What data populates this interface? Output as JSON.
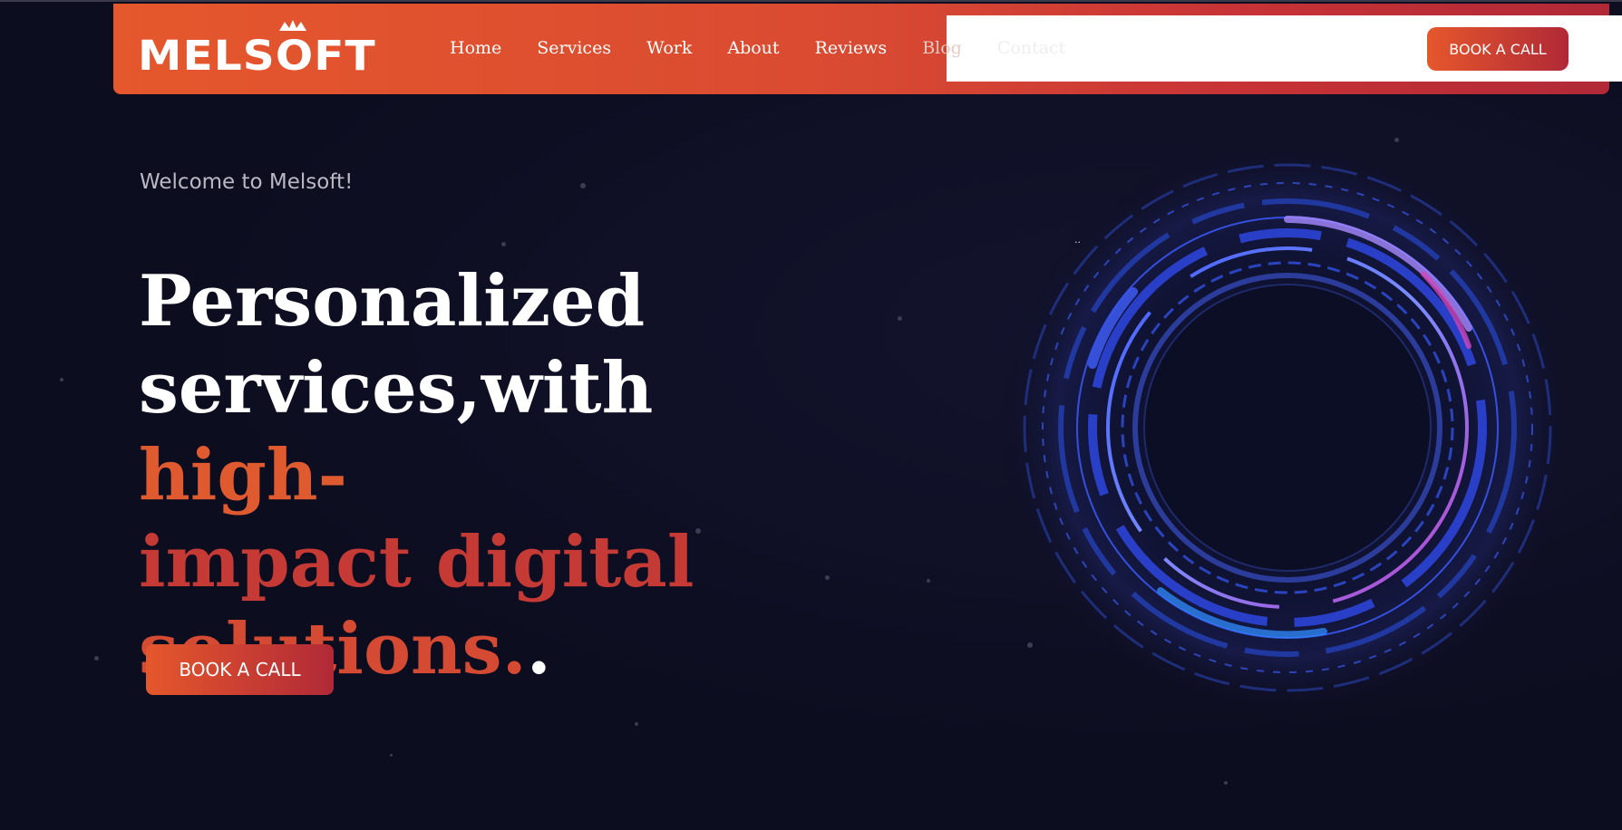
{
  "brand": {
    "name": "MELSOFT"
  },
  "nav": {
    "items": [
      {
        "label": "Home"
      },
      {
        "label": "Services"
      },
      {
        "label": "Work"
      },
      {
        "label": "About"
      },
      {
        "label": "Reviews"
      },
      {
        "label": "Blog"
      },
      {
        "label": "Contact"
      }
    ],
    "cta_label": "BOOK A CALL"
  },
  "hero": {
    "welcome": "Welcome to Melsoft!",
    "headline_part1": "Personalized",
    "headline_part2": "services,with ",
    "headline_part3": "high-",
    "headline_part4": "impact digital",
    "headline_part5": "solutions.",
    "headline_part6": ".",
    "cta_label": "BOOK A CALL",
    "image_alt": ".."
  },
  "colors": {
    "accent_orange": "#e5572c",
    "accent_red": "#b12937",
    "background": "#0d0d20",
    "ring_blue": "#3a5bff"
  }
}
